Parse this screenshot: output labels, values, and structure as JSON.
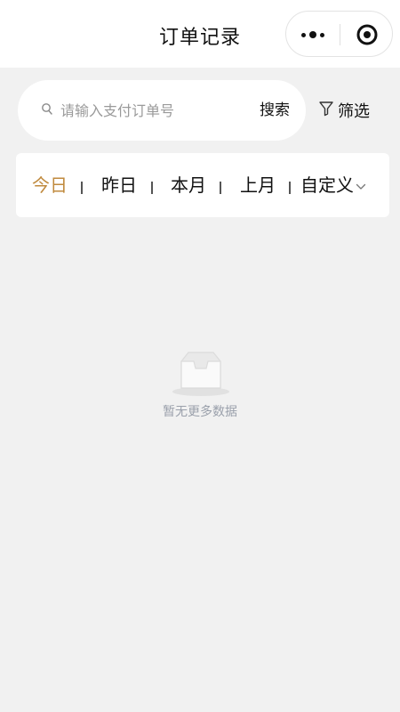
{
  "header": {
    "title": "订单记录"
  },
  "search": {
    "placeholder": "请输入支付订单号",
    "button_label": "搜索"
  },
  "filter": {
    "label": "筛选"
  },
  "date_tabs": [
    {
      "label": "今日",
      "active": true
    },
    {
      "label": "昨日",
      "active": false
    },
    {
      "label": "本月",
      "active": false
    },
    {
      "label": "上月",
      "active": false
    },
    {
      "label": "自定义",
      "active": false
    }
  ],
  "empty_state": {
    "message": "暂无更多数据"
  },
  "colors": {
    "accent": "#c08a3e",
    "background": "#f1f1f1",
    "muted_text": "#9aa0ab"
  }
}
